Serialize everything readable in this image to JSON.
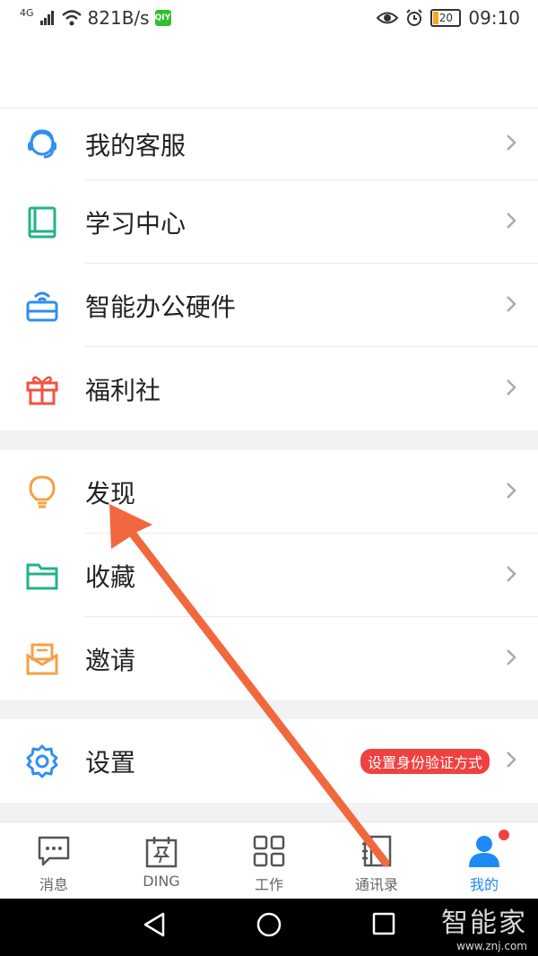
{
  "status": {
    "network": "4G",
    "speed": "821B/s",
    "app": "QIYI",
    "battery": "20",
    "time": "09:10"
  },
  "groups": [
    {
      "items": [
        {
          "name": "customer-service",
          "label": "我的客服",
          "icon": "headset-icon",
          "color": "#2f8ff0"
        },
        {
          "name": "learning-center",
          "label": "学习中心",
          "icon": "book-icon",
          "color": "#22b386"
        },
        {
          "name": "smart-office-hardware",
          "label": "智能办公硬件",
          "icon": "wifi-box-icon",
          "color": "#2f8ff0"
        },
        {
          "name": "welfare",
          "label": "福利社",
          "icon": "gift-icon",
          "color": "#f0533f"
        }
      ]
    },
    {
      "items": [
        {
          "name": "discover",
          "label": "发现",
          "icon": "lightbulb-icon",
          "color": "#f5a045"
        },
        {
          "name": "favorites",
          "label": "收藏",
          "icon": "folder-icon",
          "color": "#22b386"
        },
        {
          "name": "invite",
          "label": "邀请",
          "icon": "envelope-icon",
          "color": "#f5a045"
        }
      ]
    },
    {
      "items": [
        {
          "name": "settings",
          "label": "设置",
          "icon": "gear-icon",
          "color": "#2f8ff0",
          "badge": "设置身份验证方式"
        }
      ]
    }
  ],
  "tabs": [
    {
      "name": "messages",
      "label": "消息",
      "icon": "chat-icon"
    },
    {
      "name": "ding",
      "label": "DING",
      "icon": "calendar-pin-icon"
    },
    {
      "name": "work",
      "label": "工作",
      "icon": "grid-icon"
    },
    {
      "name": "contacts",
      "label": "通讯录",
      "icon": "contacts-icon"
    },
    {
      "name": "me",
      "label": "我的",
      "icon": "person-icon",
      "active": true
    }
  ],
  "watermark": {
    "title": "智能家",
    "url": "www.znj.com"
  },
  "colors": {
    "accent": "#1e8af6",
    "arrow": "#f2683e",
    "badge": "#f04141"
  }
}
